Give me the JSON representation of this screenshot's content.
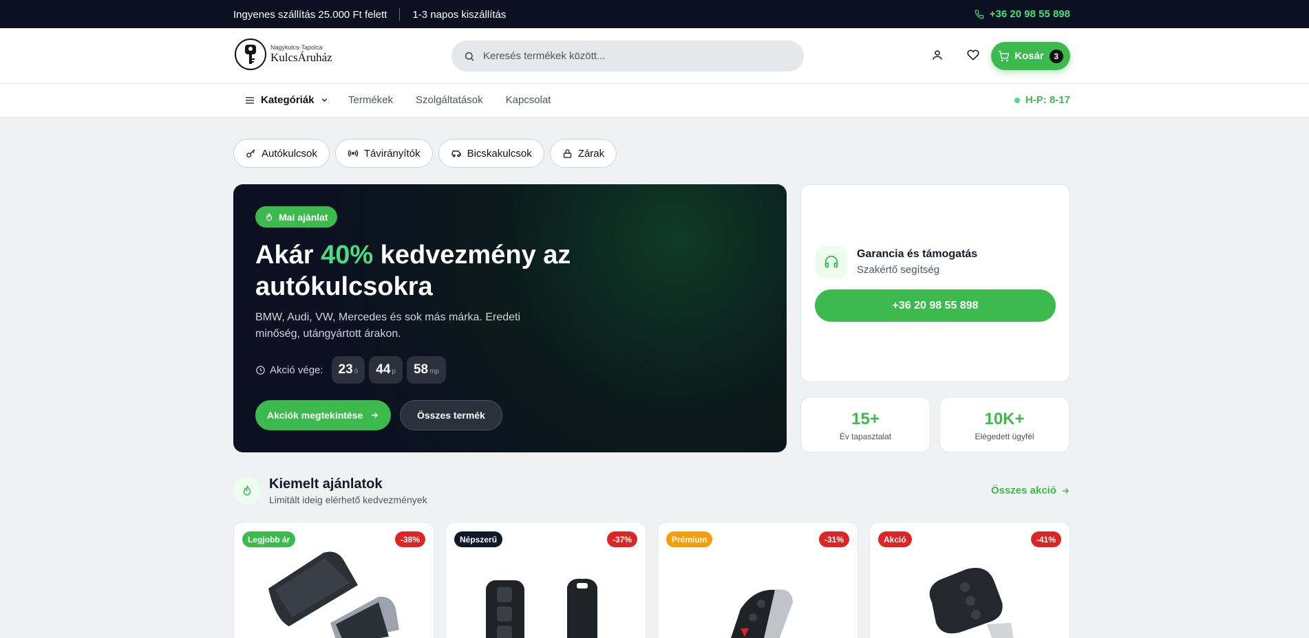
{
  "topbar": {
    "shipping_free": "Ingyenes szállítás 25.000 Ft felett",
    "shipping_time": "1-3 napos kiszállítás",
    "phone": "+36 20 98 55 898"
  },
  "header": {
    "logo_small": "Nagykulcs-Tapolca",
    "logo_name": "KulcsÁruház",
    "search_placeholder": "Keresés termékek között...",
    "cart_label": "Kosár",
    "cart_count": "3"
  },
  "nav": {
    "categories_label": "Kategóriák",
    "links": [
      "Termékek",
      "Szolgáltatások",
      "Kapcsolat"
    ],
    "hours": "H-P: 8-17"
  },
  "chips": [
    "Autókulcsok",
    "Távirányítók",
    "Bicskakulcsok",
    "Zárak"
  ],
  "hero": {
    "pill": "Mai ajánlat",
    "title_pre": "Akár ",
    "title_highlight": "40%",
    "title_post": " kedvezmény az autókulcsokra",
    "description": "BMW, Audi, VW, Mercedes és sok más márka. Eredeti minőség, utángyártott árakon.",
    "countdown_label": "Akció vége:",
    "countdown": [
      {
        "value": "23",
        "unit": "ó"
      },
      {
        "value": "44",
        "unit": "p"
      },
      {
        "value": "58",
        "unit": "mp"
      }
    ],
    "primary_button": "Akciók megtekintése",
    "secondary_button": "Összes termék"
  },
  "support": {
    "title": "Garancia és támogatás",
    "subtitle": "Szakértő segítség",
    "phone_button": "+36 20 98 55 898"
  },
  "stats": [
    {
      "value": "15+",
      "label": "Év tapasztalat"
    },
    {
      "value": "10K+",
      "label": "Elégedett ügyfél"
    }
  ],
  "featured": {
    "title": "Kiemelt ajánlatok",
    "subtitle": "Limitált ideig elérhető kedvezmények",
    "all_link": "Összes akció"
  },
  "products": [
    {
      "tag": "Legjobb ár",
      "tag_color": "#3dba4e",
      "discount": "-38%"
    },
    {
      "tag": "Népszerű",
      "tag_color": "#111827",
      "discount": "-37%"
    },
    {
      "tag": "Prémium",
      "tag_color": "#f59e0b",
      "discount": "-31%"
    },
    {
      "tag": "Akció",
      "tag_color": "#dc2626",
      "discount": "-41%"
    }
  ],
  "colors": {
    "accent": "#3dba4e",
    "dark": "#0b1120",
    "discount": "#dc2626"
  }
}
